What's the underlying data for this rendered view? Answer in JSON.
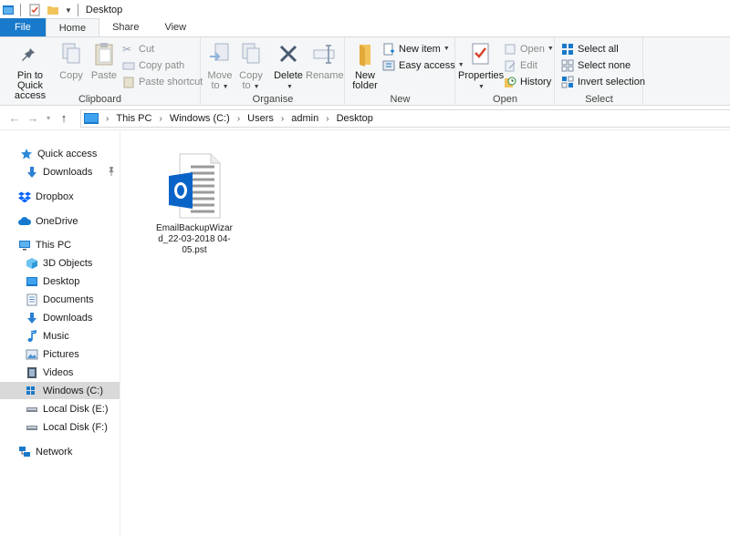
{
  "window": {
    "title": "Desktop"
  },
  "tabs": [
    {
      "label": "File"
    },
    {
      "label": "Home"
    },
    {
      "label": "Share"
    },
    {
      "label": "View"
    }
  ],
  "ribbon": {
    "clipboard": {
      "label": "Clipboard",
      "pin_line1": "Pin to Quick",
      "pin_line2": "access",
      "copy": "Copy",
      "paste": "Paste",
      "cut": "Cut",
      "copy_path": "Copy path",
      "paste_shortcut": "Paste shortcut"
    },
    "organise": {
      "label": "Organise",
      "move_line1": "Move",
      "move_line2": "to",
      "copy_line1": "Copy",
      "copy_line2": "to",
      "delete": "Delete",
      "rename": "Rename"
    },
    "new": {
      "label": "New",
      "new_folder_line1": "New",
      "new_folder_line2": "folder",
      "new_item": "New item",
      "easy_access": "Easy access"
    },
    "open": {
      "label": "Open",
      "properties": "Properties",
      "open": "Open",
      "edit": "Edit",
      "history": "History"
    },
    "select": {
      "label": "Select",
      "select_all": "Select all",
      "select_none": "Select none",
      "invert_selection": "Invert selection"
    }
  },
  "address": {
    "crumbs": [
      "This PC",
      "Windows (C:)",
      "Users",
      "admin",
      "Desktop"
    ]
  },
  "sidebar": {
    "items": [
      {
        "label": "Quick access",
        "icon": "star-icon"
      },
      {
        "label": "Downloads",
        "icon": "download-arrow-icon"
      },
      {
        "label": "Dropbox",
        "icon": "dropbox-icon"
      },
      {
        "label": "OneDrive",
        "icon": "cloud-icon"
      },
      {
        "label": "This PC",
        "icon": "monitor-icon"
      },
      {
        "label": "3D Objects",
        "icon": "cube-icon"
      },
      {
        "label": "Desktop",
        "icon": "desktop-icon"
      },
      {
        "label": "Documents",
        "icon": "document-icon"
      },
      {
        "label": "Downloads",
        "icon": "download-arrow-icon"
      },
      {
        "label": "Music",
        "icon": "music-note-icon"
      },
      {
        "label": "Pictures",
        "icon": "picture-icon"
      },
      {
        "label": "Videos",
        "icon": "film-icon"
      },
      {
        "label": "Windows (C:)",
        "icon": "windows-drive-icon"
      },
      {
        "label": "Local Disk (E:)",
        "icon": "drive-icon"
      },
      {
        "label": "Local Disk (F:)",
        "icon": "drive-icon"
      },
      {
        "label": "Network",
        "icon": "network-icon"
      }
    ]
  },
  "files": [
    {
      "name": "EmailBackupWizard_22-03-2018 04-05.pst",
      "icon": "outlook-pst-icon"
    }
  ],
  "colors": {
    "accent": "#1979ca",
    "outlook_blue": "#0a64c8"
  }
}
